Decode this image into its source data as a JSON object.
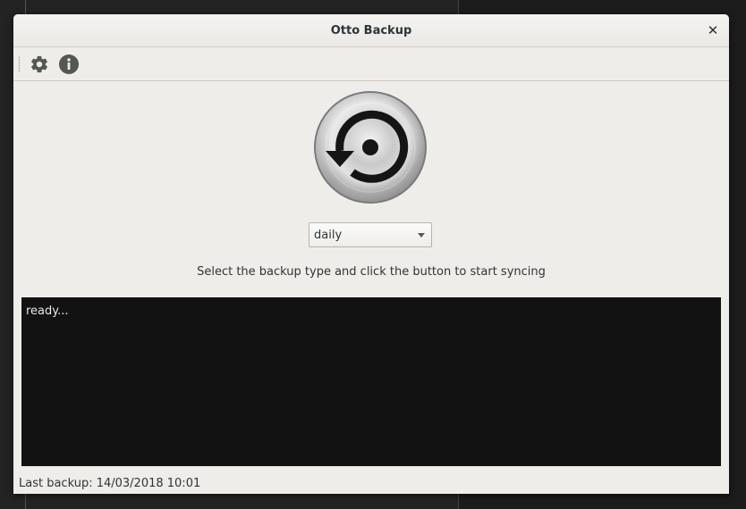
{
  "window": {
    "title": "Otto Backup",
    "close_glyph": "✕"
  },
  "toolbar": {
    "settings_icon": "gear-icon",
    "about_icon": "info-icon"
  },
  "backup_type": {
    "selected": "daily"
  },
  "instruction": "Select the backup type and click the button to start syncing",
  "console": {
    "text": "ready..."
  },
  "status": {
    "last_backup": "Last backup: 14/03/2018 10:01"
  },
  "colors": {
    "window_bg": "#efedea",
    "console_bg": "#121212",
    "console_text": "#e8e8e8",
    "icon": "#555753"
  }
}
